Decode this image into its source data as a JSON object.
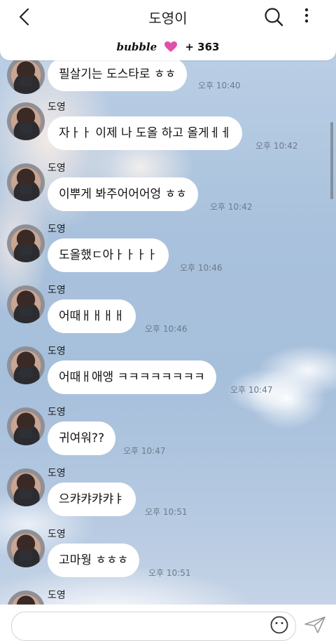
{
  "header": {
    "title": "도영이",
    "back_icon": "chevron-left-icon",
    "search_icon": "search-icon",
    "more_icon": "more-vertical-icon"
  },
  "banner": {
    "brand": "bubble",
    "count": "+ 363",
    "heart_color": "#e14fa8"
  },
  "messages": [
    {
      "name": "",
      "text": "필살기는 도스타로 ㅎㅎ",
      "time": "오후 10:40"
    },
    {
      "name": "도영",
      "text": "자ㅏㅏ 이제 나 도올 하고 올게ㅔㅔ",
      "time": "오후 10:42"
    },
    {
      "name": "도영",
      "text": "이뿌게 봐주어어어엉 ㅎㅎ",
      "time": "오후 10:42"
    },
    {
      "name": "도영",
      "text": "도올했ㄷ아ㅏㅏㅏㅏ",
      "time": "오후 10:46"
    },
    {
      "name": "도영",
      "text": "어때ㅐㅐㅐㅐ",
      "time": "오후 10:46"
    },
    {
      "name": "도영",
      "text": "어때ㅐ애앵 ㅋㅋㅋㅋㅋㅋㅋㅋ",
      "time": "오후 10:47"
    },
    {
      "name": "도영",
      "text": "귀여워??",
      "time": "오후 10:47"
    },
    {
      "name": "도영",
      "text": "으캬캬캬캬ㅑ",
      "time": "오후 10:51"
    },
    {
      "name": "도영",
      "text": "고마웡 ㅎㅎㅎ",
      "time": "오후 10:51"
    },
    {
      "name": "도영",
      "text": "",
      "time": ""
    }
  ]
}
